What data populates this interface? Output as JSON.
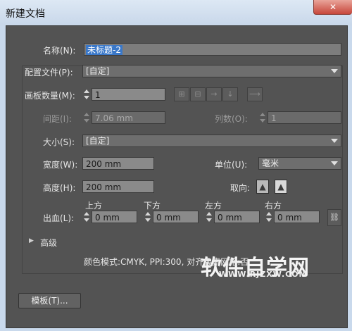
{
  "window": {
    "title": "新建文档",
    "close_glyph": "✕"
  },
  "name": {
    "label": "名称(N):",
    "value": "未标题-2"
  },
  "profile": {
    "label": "配置文件(P):",
    "value": "[自定]"
  },
  "artboards": {
    "count_label": "画板数量(M):",
    "count_value": "1",
    "spacing_label": "间距(I):",
    "spacing_value": "7.06 mm",
    "columns_label": "列数(O):",
    "columns_value": "1",
    "layout_icons": [
      "grid-by-row-icon",
      "grid-by-column-icon",
      "arrange-by-row-icon",
      "arrange-by-column-icon",
      "right-to-left-icon"
    ]
  },
  "size": {
    "label": "大小(S):",
    "value": "[自定]"
  },
  "width": {
    "label": "宽度(W):",
    "value": "200 mm"
  },
  "units": {
    "label": "单位(U):",
    "value": "毫米"
  },
  "height": {
    "label": "高度(H):",
    "value": "200 mm"
  },
  "orientation": {
    "label": "取向:",
    "portrait_glyph": "▲",
    "landscape_glyph": "▲"
  },
  "bleed": {
    "label": "出血(L):",
    "top": {
      "label": "上方",
      "value": "0 mm"
    },
    "bottom": {
      "label": "下方",
      "value": "0 mm"
    },
    "left": {
      "label": "左方",
      "value": "0 mm"
    },
    "right": {
      "label": "右方",
      "value": "0 mm"
    },
    "link_glyph": "⛓"
  },
  "advanced": {
    "label": "高级",
    "summary": "颜色模式:CMYK, PPI:300, 对齐像素网格:否"
  },
  "templates_button": "模板(T)...",
  "watermark": {
    "text": "软件自学网",
    "url": "WWW.RJZXW.COM"
  }
}
